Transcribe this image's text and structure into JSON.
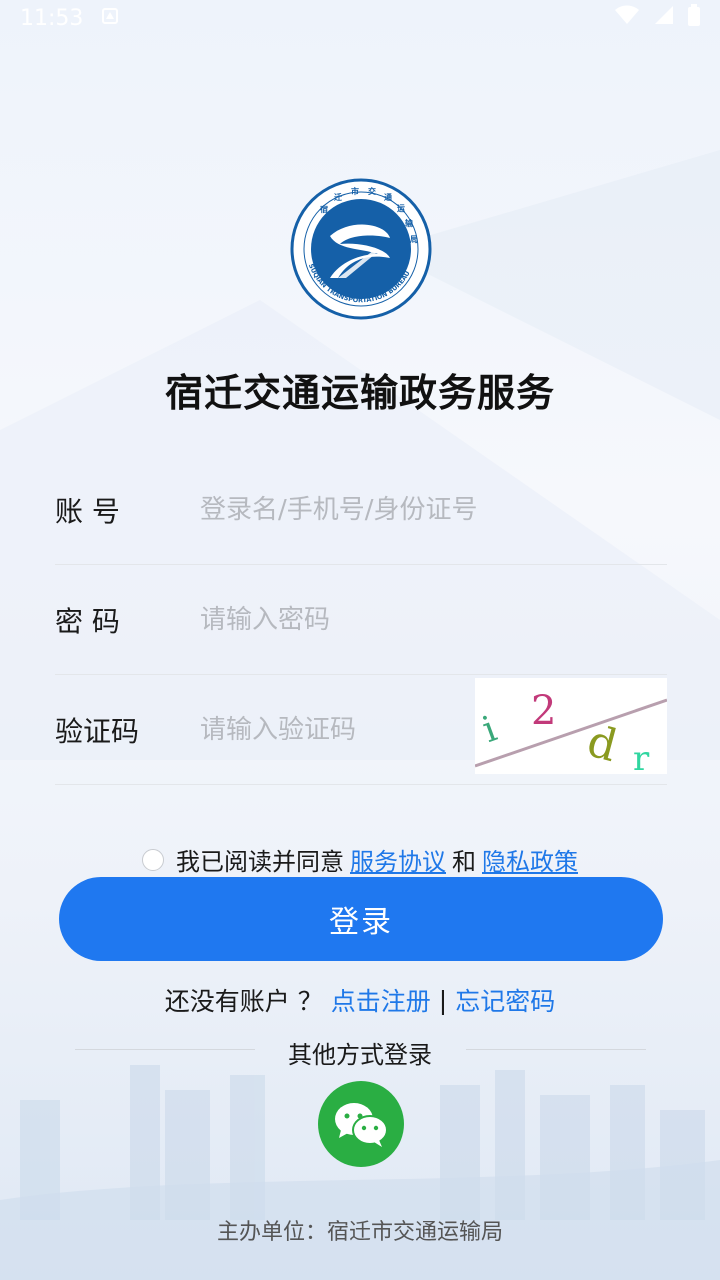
{
  "status_bar": {
    "time": "11:53"
  },
  "app": {
    "title": "宿迁交通运输政务服务",
    "logo": {
      "ring_text": "宿 迁 市 交 通 运 输 局",
      "ring_text_en": "SUQIAN TRANSPORTATION BUREAU"
    }
  },
  "form": {
    "account": {
      "label": "账 号",
      "placeholder": "登录名/手机号/身份证号"
    },
    "password": {
      "label": "密 码",
      "placeholder": "请输入密码"
    },
    "captcha": {
      "label": "验证码",
      "placeholder": "请输入验证码",
      "code": "i2dr"
    }
  },
  "agreement": {
    "prefix": "我已阅读并同意",
    "service_link": "服务协议",
    "and": "和",
    "privacy_link": "隐私政策",
    "checked": false
  },
  "login_button": "登录",
  "register": {
    "prompt": "还没有账户 ？",
    "register_link": "点击注册",
    "separator": "|",
    "forgot_link": "忘记密码"
  },
  "other_login": {
    "label": "其他方式登录",
    "wechat_icon": "wechat-icon"
  },
  "footer": "主办单位：宿迁市交通运输局",
  "colors": {
    "primary": "#1f78f0",
    "link": "#1f78e8",
    "wechat": "#2aae43",
    "logo_blue": "#1560a8"
  }
}
